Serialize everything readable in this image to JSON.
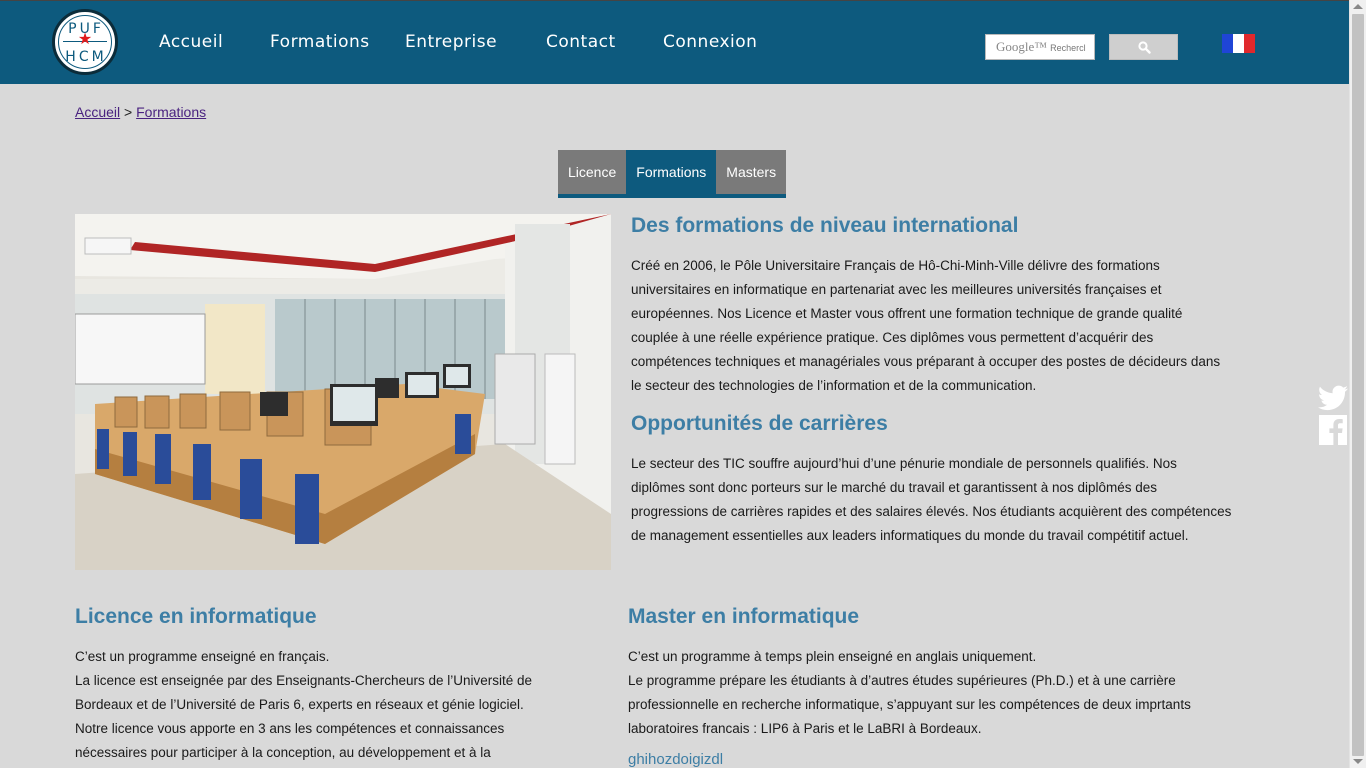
{
  "header": {
    "logo_top": "PUF",
    "logo_bottom": "HCM",
    "nav": [
      "Accueil",
      "Formations",
      "Entreprise",
      "Contact",
      "Connexion"
    ],
    "search_brand": "Google™",
    "search_placeholder": "Rechercl",
    "flag_colors": [
      "#1f45d6",
      "#ffffff",
      "#e0282c"
    ]
  },
  "breadcrumb": {
    "home": "Accueil",
    "sep": " > ",
    "current": "Formations"
  },
  "tabs": [
    {
      "label": "Licence",
      "active": false
    },
    {
      "label": "Formations",
      "active": true
    },
    {
      "label": "Masters",
      "active": false
    }
  ],
  "intro": {
    "title": "Des formations de niveau international",
    "lines": [
      "Créé en 2006, le Pôle Universitaire Français de Hô-Chi-Minh-Ville délivre des formations",
      "universitaires en informatique en partenariat avec les meilleures universités françaises et",
      "européennes. Nos Licence et Master vous offrent une formation technique de grande qualité",
      "couplée à une réelle expérience pratique. Ces diplômes vous permettent d’acquérir des",
      "compétences techniques et managériales vous préparant à occuper des postes de décideurs dans",
      "le secteur des technologies de l’information et de la communication."
    ]
  },
  "careers": {
    "title": "Opportunités de carrières",
    "lines": [
      "Le secteur des TIC souffre aujourd’hui d’une pénurie mondiale de personnels qualifiés. Nos",
      "diplômes sont donc porteurs sur le marché du travail et garantissent à nos diplômés des",
      "progressions de carrières rapides et des salaires élevés. Nos étudiants acquièrent des compétences",
      "de management essentielles aux leaders informatiques du monde du travail compétitif actuel."
    ]
  },
  "licence": {
    "title": "Licence en informatique",
    "lines": [
      "C’est un programme enseigné en français.",
      "La licence est enseignée par des Enseignants-Chercheurs de l’Université de",
      "Bordeaux et de l’Université de Paris 6, experts en réseaux et génie logiciel.",
      "Notre licence vous apporte en 3 ans les compétences et connaissances",
      "nécessaires pour participer à la conception, au développement et à la"
    ]
  },
  "master": {
    "title": "Master en informatique",
    "lines": [
      "C’est un programme à temps plein enseigné en anglais uniquement.",
      "Le programme prépare les étudiants à d’autres études supérieures (Ph.D.) et à une carrière",
      "professionnelle en recherche informatique, s’appuyant sur les compétences de deux imprtants",
      "laboratoires francais : LIP6 à Paris et le LaBRI à Bordeaux."
    ],
    "link": "ghihozdoigizdl"
  },
  "icons": {
    "twitter": "twitter-icon",
    "facebook": "facebook-icon",
    "search": "search-icon"
  },
  "colors": {
    "brand": "#0d5a7e",
    "heading": "#3d7ea5",
    "background": "#d9d9d9",
    "tab_inactive": "#7a7a7a"
  }
}
